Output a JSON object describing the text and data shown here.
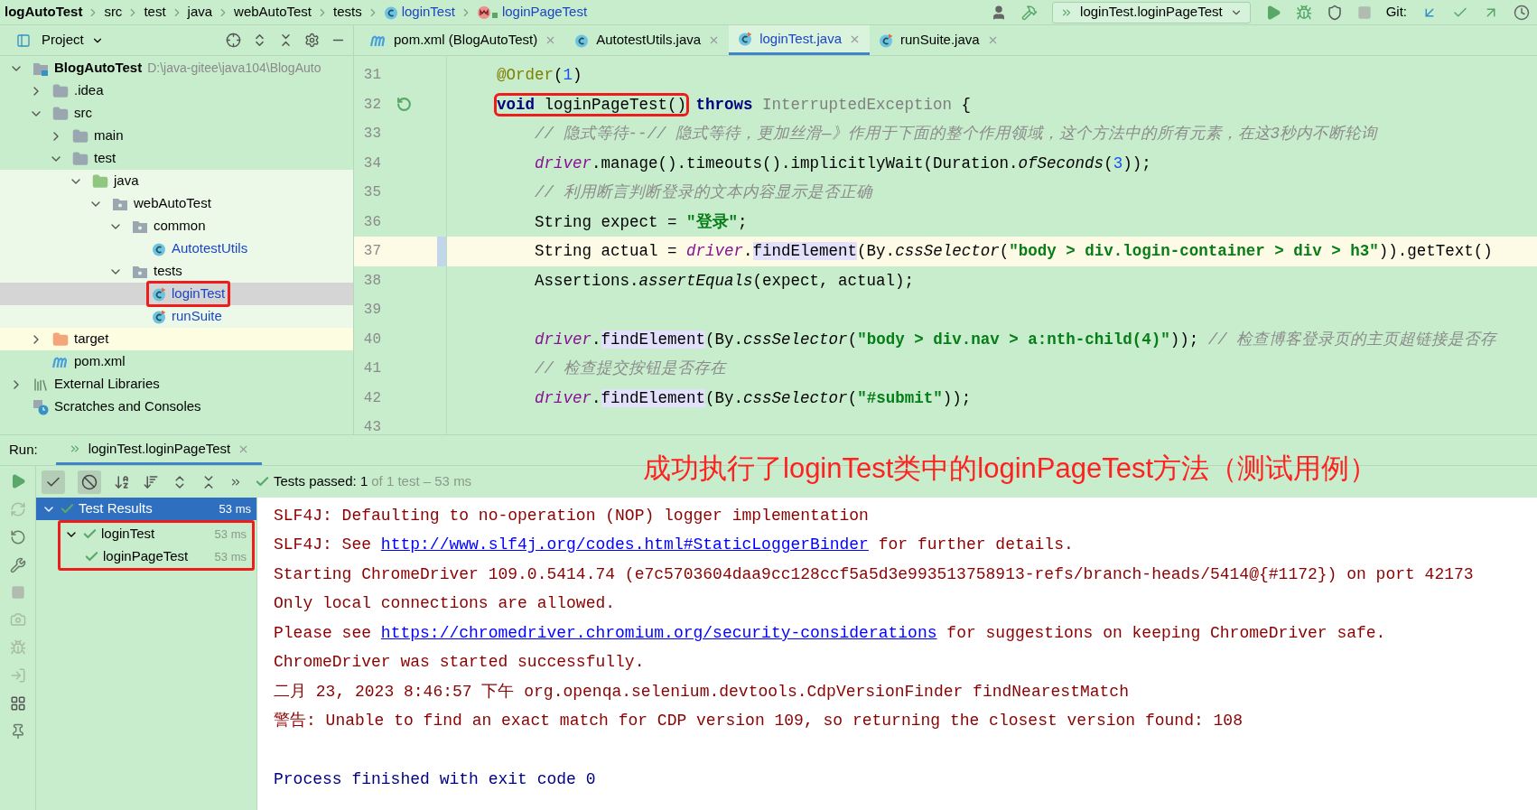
{
  "breadcrumb": [
    {
      "label": "logAutoTest",
      "kind": "module"
    },
    {
      "label": "src",
      "kind": "folder"
    },
    {
      "label": "test",
      "kind": "folder"
    },
    {
      "label": "java",
      "kind": "folder"
    },
    {
      "label": "webAutoTest",
      "kind": "folder"
    },
    {
      "label": "tests",
      "kind": "folder"
    },
    {
      "label": "loginTest",
      "kind": "class"
    },
    {
      "label": "loginPageTest",
      "kind": "method"
    }
  ],
  "toolbar": {
    "run_config": "loginTest.loginPageTest",
    "actions": [
      {
        "kind": "run",
        "disabled": false
      },
      {
        "kind": "debug",
        "disabled": false
      },
      {
        "kind": "coverage",
        "disabled": false
      },
      {
        "kind": "stop",
        "disabled": true
      }
    ],
    "git_label": "Git:"
  },
  "project_panel": {
    "title": "Project",
    "tree": [
      {
        "label": "BlogAutoTest",
        "path": "D:\\java-gitee\\java104\\BlogAuto",
        "kind": "module",
        "expanded": true,
        "selected": false,
        "children": [
          {
            "label": ".idea",
            "kind": "folder",
            "expanded": false,
            "selected": false
          },
          {
            "label": "src",
            "kind": "folder",
            "expanded": true,
            "selected": false,
            "children": [
              {
                "label": "main",
                "kind": "folder",
                "expanded": false,
                "selected": false
              },
              {
                "label": "test",
                "kind": "folder",
                "expanded": true,
                "selected": false,
                "children": [
                  {
                    "label": "java",
                    "kind": "test-root",
                    "expanded": true,
                    "selected": false,
                    "children": [
                      {
                        "label": "webAutoTest",
                        "kind": "package",
                        "expanded": true,
                        "selected": false,
                        "children": [
                          {
                            "label": "common",
                            "kind": "package",
                            "expanded": true,
                            "selected": false,
                            "children": [
                              {
                                "label": "AutotestUtils",
                                "kind": "class",
                                "selected": false
                              }
                            ]
                          },
                          {
                            "label": "tests",
                            "kind": "package",
                            "expanded": true,
                            "selected": false,
                            "children": [
                              {
                                "label": "loginTest",
                                "kind": "test-class",
                                "selected": true,
                                "boxed": true
                              },
                              {
                                "label": "runSuite",
                                "kind": "test-class",
                                "selected": false
                              }
                            ]
                          }
                        ]
                      }
                    ]
                  }
                ]
              }
            ]
          },
          {
            "label": "target",
            "kind": "excluded",
            "expanded": false,
            "selected": false
          },
          {
            "label": "pom.xml",
            "kind": "maven",
            "selected": false
          }
        ]
      },
      {
        "label": "External Libraries",
        "kind": "libraries",
        "expanded": false,
        "selected": false
      },
      {
        "label": "Scratches and Consoles",
        "kind": "scratches",
        "selected": false
      }
    ]
  },
  "editor_tabs": [
    {
      "label": "pom.xml (BlogAutoTest)",
      "kind": "maven",
      "selected": false
    },
    {
      "label": "AutotestUtils.java",
      "kind": "class",
      "selected": false
    },
    {
      "label": "loginTest.java",
      "kind": "test-class",
      "selected": true
    },
    {
      "label": "runSuite.java",
      "kind": "test-class",
      "selected": false
    }
  ],
  "code": [
    {
      "number": "31",
      "current": false,
      "tokens": [
        {
          "text": "@Order",
          "kind": "annotation"
        },
        {
          "text": "(",
          "kind": "plain"
        },
        {
          "text": "1",
          "kind": "number"
        },
        {
          "text": ")",
          "kind": "plain"
        }
      ]
    },
    {
      "number": "32",
      "current": false,
      "run_marker": true,
      "tokens": [
        {
          "kind": "group",
          "boxed": true,
          "parts": [
            {
              "text": "void",
              "kind": "keyword"
            },
            {
              "text": " loginPageTest()",
              "kind": "plain"
            }
          ]
        },
        {
          "text": " throws",
          "kind": "keyword"
        },
        {
          "text": " InterruptedException",
          "kind": "dim"
        },
        {
          "text": " {",
          "kind": "plain"
        }
      ]
    },
    {
      "number": "33",
      "current": false,
      "tokens": [
        {
          "text": "    // 隐式等待--// 隐式等待，更加丝滑—》作用于下面的整个作用领域，这个方法中的所有元素，在这3秒内不断轮询",
          "kind": "comment"
        }
      ]
    },
    {
      "number": "34",
      "current": false,
      "tokens": [
        {
          "text": "    driver",
          "kind": "field"
        },
        {
          "text": ".manage().timeouts().implicitlyWait(Duration.",
          "kind": "plain"
        },
        {
          "text": "ofSeconds",
          "kind": "static"
        },
        {
          "text": "(",
          "kind": "plain"
        },
        {
          "text": "3",
          "kind": "number"
        },
        {
          "text": "));",
          "kind": "plain"
        }
      ]
    },
    {
      "number": "35",
      "current": false,
      "tokens": [
        {
          "text": "    // 利用断言判断登录的文本内容显示是否正确",
          "kind": "comment"
        }
      ]
    },
    {
      "number": "36",
      "current": false,
      "tokens": [
        {
          "text": "    String expect = ",
          "kind": "plain"
        },
        {
          "text": "\"登录\"",
          "kind": "string"
        },
        {
          "text": ";",
          "kind": "plain"
        }
      ]
    },
    {
      "number": "37",
      "current": true,
      "tokens": [
        {
          "text": "    String actual = ",
          "kind": "plain"
        },
        {
          "text": "driver",
          "kind": "field"
        },
        {
          "text": ".",
          "kind": "plain"
        },
        {
          "text": "findElement",
          "kind": "usage"
        },
        {
          "text": "(By.",
          "kind": "plain"
        },
        {
          "text": "cssSelector",
          "kind": "static"
        },
        {
          "text": "(",
          "kind": "plain"
        },
        {
          "text": "\"body > div.login-container > div > h3\"",
          "kind": "string"
        },
        {
          "text": ")).getText()",
          "kind": "plain"
        }
      ]
    },
    {
      "number": "38",
      "current": false,
      "tokens": [
        {
          "text": "    Assertions.",
          "kind": "plain"
        },
        {
          "text": "assertEquals",
          "kind": "static"
        },
        {
          "text": "(expect, actual);",
          "kind": "plain"
        }
      ]
    },
    {
      "number": "39",
      "current": false
    },
    {
      "number": "40",
      "current": false,
      "tokens": [
        {
          "text": "    driver",
          "kind": "field"
        },
        {
          "text": ".",
          "kind": "plain"
        },
        {
          "text": "findElement",
          "kind": "usage"
        },
        {
          "text": "(By.",
          "kind": "plain"
        },
        {
          "text": "cssSelector",
          "kind": "static"
        },
        {
          "text": "(",
          "kind": "plain"
        },
        {
          "text": "\"body > div.nav > a:nth-child(4)\"",
          "kind": "string"
        },
        {
          "text": ")); ",
          "kind": "plain"
        },
        {
          "text": "// 检查博客登录页的主页超链接是否存",
          "kind": "comment"
        }
      ]
    },
    {
      "number": "41",
      "current": false,
      "tokens": [
        {
          "text": "    // 检查提交按钮是否存在",
          "kind": "comment"
        }
      ]
    },
    {
      "number": "42",
      "current": false,
      "tokens": [
        {
          "text": "    driver",
          "kind": "field"
        },
        {
          "text": ".",
          "kind": "plain"
        },
        {
          "text": "findElement",
          "kind": "usage"
        },
        {
          "text": "(By.",
          "kind": "plain"
        },
        {
          "text": "cssSelector",
          "kind": "static"
        },
        {
          "text": "(",
          "kind": "plain"
        },
        {
          "text": "\"#submit\"",
          "kind": "string"
        },
        {
          "text": "));",
          "kind": "plain"
        }
      ]
    },
    {
      "number": "43",
      "current": false
    }
  ],
  "run_panel": {
    "label": "Run:",
    "tabs": [
      {
        "label": "loginTest.loginPageTest",
        "selected": true
      }
    ],
    "status": "Tests passed: 1",
    "status_detail": "of 1 test – 53 ms",
    "caption": "成功执行了loginTest类中的loginPageTest方法（测试用例）",
    "test_tree": [
      {
        "label": "Test Results",
        "time": "53 ms",
        "passed": true,
        "expanded": true,
        "selected": true,
        "children": [
          {
            "label": "loginTest",
            "time": "53 ms",
            "passed": true,
            "expanded": true,
            "selected": false,
            "boxed": true,
            "children": [
              {
                "label": "loginPageTest",
                "time": "53 ms",
                "passed": true,
                "selected": false
              }
            ]
          }
        ]
      }
    ],
    "console": [
      {
        "kind": "stderr",
        "segments": [
          {
            "text": "SLF4J: Defaulting to no-operation (NOP) logger implementation"
          }
        ]
      },
      {
        "kind": "stderr",
        "segments": [
          {
            "text": "SLF4J: See "
          },
          {
            "text": "http://www.slf4j.org/codes.html#StaticLoggerBinder",
            "link": true
          },
          {
            "text": " for further details."
          }
        ]
      },
      {
        "kind": "stderr",
        "segments": [
          {
            "text": "Starting ChromeDriver 109.0.5414.74 (e7c5703604daa9cc128ccf5a5d3e993513758913-refs/branch-heads/5414@{#1172}) on port 42173"
          }
        ]
      },
      {
        "kind": "stderr",
        "segments": [
          {
            "text": "Only local connections are allowed."
          }
        ]
      },
      {
        "kind": "stderr",
        "segments": [
          {
            "text": "Please see "
          },
          {
            "text": "https://chromedriver.chromium.org/security-considerations",
            "link": true
          },
          {
            "text": " for suggestions on keeping ChromeDriver safe."
          }
        ]
      },
      {
        "kind": "stderr",
        "segments": [
          {
            "text": "ChromeDriver was started successfully."
          }
        ]
      },
      {
        "kind": "stderr",
        "segments": [
          {
            "text": "二月 23, 2023 8:46:57 下午 org.openqa.selenium.devtools.CdpVersionFinder findNearestMatch"
          }
        ]
      },
      {
        "kind": "stderr",
        "segments": [
          {
            "text": "警告: Unable to find an exact match for CDP version 109, so returning the closest version found: 108"
          }
        ]
      },
      {
        "kind": "system",
        "spaced": true,
        "segments": [
          {
            "text": "Process finished with exit code 0"
          }
        ]
      }
    ]
  }
}
